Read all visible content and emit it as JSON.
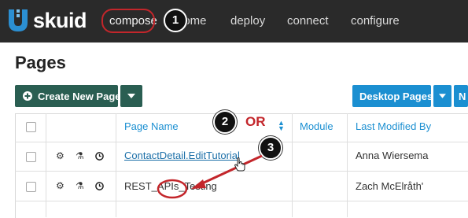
{
  "header": {
    "logo_text": "skuid",
    "nav": [
      "compose",
      "home",
      "deploy",
      "connect",
      "configure"
    ]
  },
  "annotations": {
    "callouts": [
      "1",
      "2",
      "3"
    ],
    "or_text": "OR",
    "accent_color": "#c3262b"
  },
  "page": {
    "title": "Pages",
    "create_button": "Create New Page",
    "desktop_button": "Desktop Pages",
    "cut_button": "N"
  },
  "table": {
    "columns": [
      "Page Name",
      "Module",
      "Last Modified By"
    ],
    "rows": [
      {
        "page_name": "ContactDetail.EditTutorial",
        "module": "",
        "modified_by": "Anna Wiersema"
      },
      {
        "page_name": "REST_APIs_Testing",
        "module": "",
        "modified_by": "Zach McElråth'"
      }
    ]
  },
  "icons": [
    "logo-mark-icon",
    "plus-circle-icon",
    "caret-down-icon",
    "gears-icon",
    "flask-icon",
    "clock-icon",
    "sort-icon",
    "hand-pointer-icon",
    "arrow-icon"
  ]
}
